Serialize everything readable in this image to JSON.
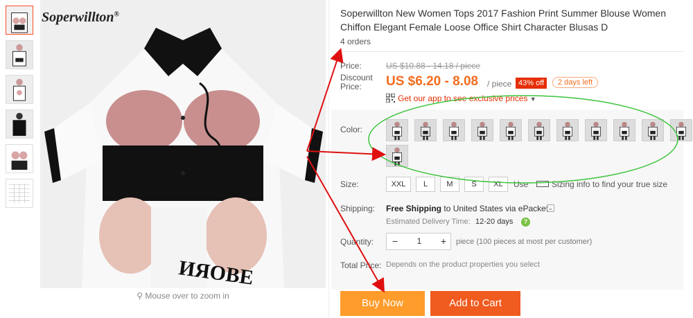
{
  "brand": "Soperwillton",
  "brand_mark": "®",
  "zoom_hint": "Mouse over to zoom in",
  "product": {
    "title": "Soperwillton New Women Tops 2017 Fashion Print Summer Blouse Women Chiffon Elegant Female Loose Office Shirt Character Blusas D",
    "orders": "4 orders"
  },
  "price": {
    "label": "Price:",
    "original": "US $10.88 - 14.18 / piece",
    "discount_label": "Discount Price:",
    "current": "US $6.20 - 8.08",
    "per_piece": "/ piece",
    "off_badge": "43% off",
    "days_left": "2 days left",
    "app_link": "Get our app to see exclusive prices"
  },
  "color": {
    "label": "Color:",
    "swatch_count": 12
  },
  "size": {
    "label": "Size:",
    "options": [
      "XXL",
      "L",
      "M",
      "S",
      "XL"
    ],
    "use_text": "Use",
    "sizing_info": "Sizing info",
    "find_text": "to find your true size"
  },
  "shipping": {
    "label": "Shipping:",
    "method_prefix": "Free Shipping",
    "to_text": "to",
    "country": "United States",
    "via_text": "via",
    "carrier": "ePacket",
    "delivery_label": "Estimated Delivery Time:",
    "delivery_days": "12-20 days",
    "help_icon_glyph": "?"
  },
  "quantity": {
    "label": "Quantity:",
    "minus": "−",
    "value": "1",
    "plus": "+",
    "note": "piece (100 pieces at most per customer)"
  },
  "total": {
    "label": "Total Price:",
    "note": "Depends on the product properties you select"
  },
  "actions": {
    "buy_now": "Buy Now",
    "add_to_cart": "Add to Cart"
  },
  "colors": {
    "accent_orange": "#f36c1f",
    "badge_red": "#e62e04",
    "buy_button": "#ff9c2b",
    "cart_button": "#f05b1f",
    "annotation_arrow": "#e01010",
    "annotation_ellipse": "#3cc43c"
  }
}
